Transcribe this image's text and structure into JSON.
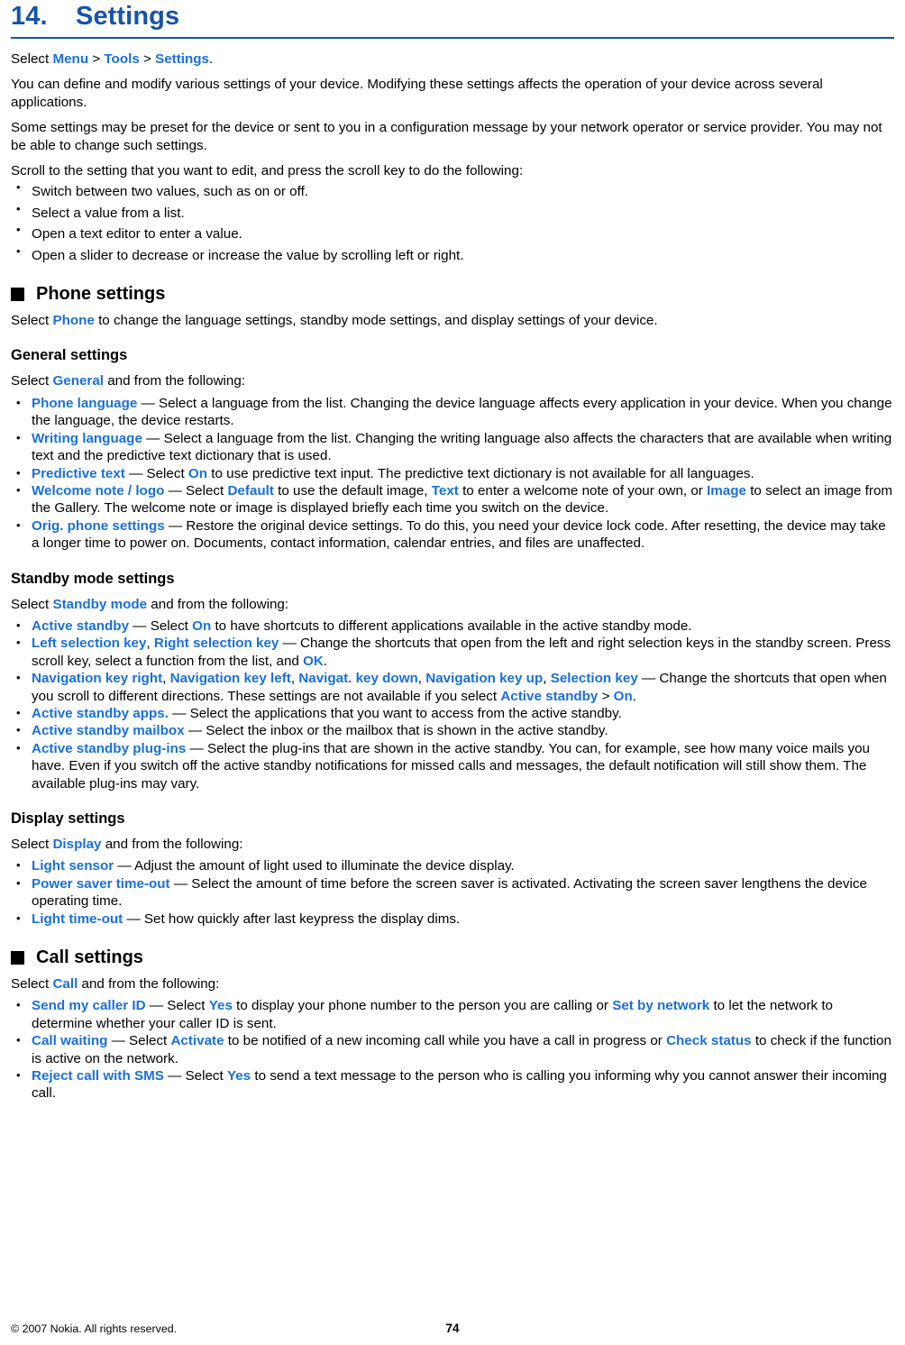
{
  "header": {
    "number": "14.",
    "title": "Settings"
  },
  "intro": {
    "select_prefix": "Select ",
    "crumb1": "Menu",
    "sep1": " > ",
    "crumb2": "Tools",
    "sep2": " > ",
    "crumb3": "Settings",
    "period": ".",
    "p1": "You can define and modify various settings of your device. Modifying these settings affects the operation of your device across several applications.",
    "p2": "Some settings may be preset for the device or sent to you in a configuration message by your network operator or service provider. You may not be able to change such settings.",
    "p3": "Scroll to the setting that you want to edit, and press the scroll key to do the following:",
    "bullets": [
      "Switch between two values, such as on or off.",
      "Select a value from a list.",
      "Open a text editor to enter a value.",
      "Open a slider to decrease or increase the value by scrolling left or right."
    ]
  },
  "phone_settings": {
    "heading": "Phone settings",
    "intro_pre": "Select ",
    "intro_link": "Phone",
    "intro_post": " to change the language settings, standby mode settings, and display settings of your device."
  },
  "general_settings": {
    "heading": "General settings",
    "intro_pre": "Select ",
    "intro_link": "General",
    "intro_post": " and from the following:",
    "items": [
      {
        "term": "Phone language",
        "dash": " — ",
        "text": "Select a language from the list. Changing the device language affects every application in your device. When you change the language, the device restarts."
      },
      {
        "term": "Writing language",
        "dash": " — ",
        "text": "Select a language from the list. Changing the writing language also affects the characters that are available when writing text and the predictive text dictionary that is used."
      },
      {
        "term": "Predictive text",
        "dash": " — ",
        "pre": "Select ",
        "inline1": "On",
        "post": " to use predictive text input. The predictive text dictionary is not available for all languages."
      },
      {
        "term": "Welcome note / logo",
        "dash": " — ",
        "pre": "Select ",
        "inline1": "Default",
        "mid1": " to use the default image, ",
        "inline2": "Text",
        "mid2": " to enter a welcome note of your own, or ",
        "inline3": "Image",
        "post": " to select an image from the Gallery. The welcome note or image is displayed briefly each time you switch on the device."
      },
      {
        "term": "Orig. phone settings",
        "dash": " — ",
        "text": "Restore the original device settings. To do this, you need your device lock code. After resetting, the device may take a longer time to power on. Documents, contact information, calendar entries, and files are unaffected."
      }
    ]
  },
  "standby_settings": {
    "heading": "Standby mode settings",
    "intro_pre": "Select ",
    "intro_link": "Standby mode",
    "intro_post": " and from the following:",
    "items": [
      {
        "term": "Active standby",
        "dash": " — ",
        "pre": "Select ",
        "inline1": "On",
        "post": " to have shortcuts to different applications available in the active standby mode."
      },
      {
        "term": "Left selection key",
        "comma1": ", ",
        "term2": "Right selection key",
        "dash": " — ",
        "pre": "Change the shortcuts that open from the left and right selection keys in the standby screen. Press scroll key, select a function from the list, and ",
        "inline1": "OK",
        "post": "."
      },
      {
        "term": "Navigation key right",
        "term2": "Navigation key left",
        "term3": "Navigat. key down",
        "term4": "Navigation key up",
        "term5": "Selection key",
        "dash": " — ",
        "pre": "Change the shortcuts that open when you scroll to different directions. These settings are not available if you select ",
        "inline1": "Active standby",
        "mid1": " > ",
        "inline2": "On",
        "post": "."
      },
      {
        "term": "Active standby apps.",
        "dash": " — ",
        "text": "Select the applications that you want to access from the active standby."
      },
      {
        "term": "Active standby mailbox",
        "dash": " — ",
        "text": "Select the inbox or the mailbox that is shown in the active standby."
      },
      {
        "term": "Active standby plug-ins",
        "dash": " — ",
        "text": "Select the plug-ins that are shown in the active standby. You can, for example, see how many voice mails you have. Even if you switch off the active standby notifications for missed calls and messages, the default notification will still show them. The available plug-ins may vary."
      }
    ]
  },
  "display_settings": {
    "heading": "Display settings",
    "intro_pre": "Select ",
    "intro_link": "Display",
    "intro_post": " and from the following:",
    "items": [
      {
        "term": "Light sensor",
        "dash": " — ",
        "text": "Adjust the amount of light used to illuminate the device display."
      },
      {
        "term": "Power saver time-out",
        "dash": " — ",
        "text": "Select the amount of time before the screen saver is activated. Activating the screen saver lengthens the device operating time."
      },
      {
        "term": "Light time-out",
        "dash": " — ",
        "text": "Set how quickly after last keypress the display dims."
      }
    ]
  },
  "call_settings": {
    "heading": "Call settings",
    "intro_pre": "Select ",
    "intro_link": "Call",
    "intro_post": " and from the following:",
    "items": [
      {
        "term": "Send my caller ID",
        "dash": " — ",
        "pre": "Select ",
        "inline1": "Yes",
        "mid1": " to display your phone number to the person you are calling or ",
        "inline2": "Set by network",
        "post": " to let the network to determine whether your caller ID is sent."
      },
      {
        "term": "Call waiting",
        "dash": " — ",
        "pre": "Select ",
        "inline1": "Activate",
        "mid1": " to be notified of a new incoming call while you have a call in progress or ",
        "inline2": "Check status",
        "post": " to check if the function is active on the network."
      },
      {
        "term": "Reject call with SMS",
        "dash": " — ",
        "pre": "Select ",
        "inline1": "Yes",
        "post": " to send a text message to the person who is calling you informing why you cannot answer their incoming call."
      }
    ]
  },
  "footer": {
    "copyright": "© 2007 Nokia. All rights reserved.",
    "page_number": "74"
  },
  "colors": {
    "title_blue": "#1554a8",
    "link_blue": "#1a6fdb",
    "text_black": "#000000"
  }
}
